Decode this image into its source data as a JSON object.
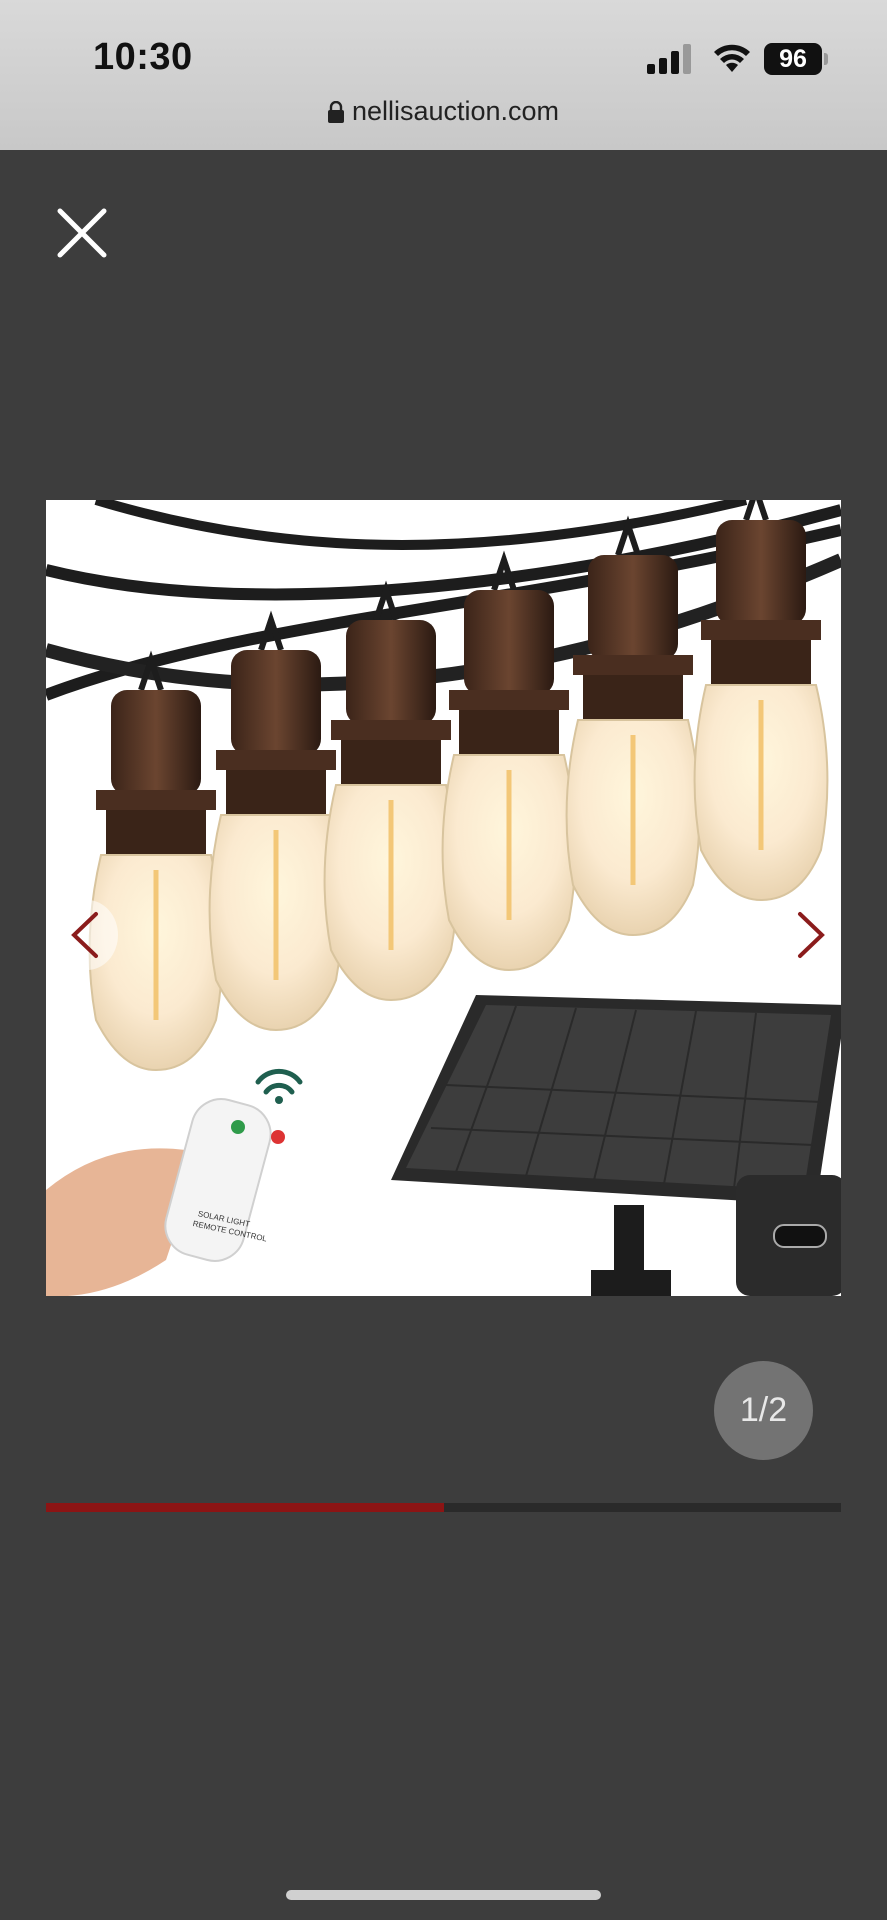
{
  "status_bar": {
    "time": "10:30",
    "battery": "96",
    "icons": [
      "signal-icon",
      "wifi-icon",
      "battery-icon"
    ]
  },
  "address_bar": {
    "domain": "nellisauction.com",
    "icon": "lock-icon"
  },
  "viewer": {
    "close_icon": "close-icon",
    "prev_icon": "chevron-left-icon",
    "next_icon": "chevron-right-icon",
    "counter": "1/2",
    "progress_fraction": 0.5,
    "accent_color": "#8c1414"
  },
  "product_image": {
    "remote_label_line1": "SOLAR LIGHT",
    "remote_label_line2": "REMOTE CONTROL"
  }
}
